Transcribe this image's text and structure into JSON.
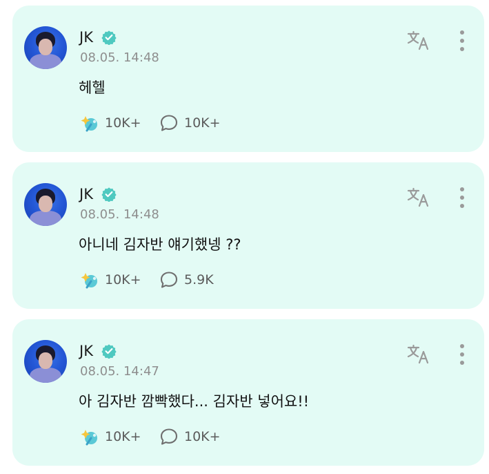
{
  "posts": [
    {
      "author": "JK",
      "timestamp": "08.05. 14:48",
      "message": "헤헬",
      "likes": "10K+",
      "comments": "10K+"
    },
    {
      "author": "JK",
      "timestamp": "08.05. 14:48",
      "message": "아니네 김자반 얘기했넹 ??",
      "likes": "10K+",
      "comments": "5.9K"
    },
    {
      "author": "JK",
      "timestamp": "08.05. 14:47",
      "message": "아 김자반 깜빡했다... 김자반 넣어요!!",
      "likes": "10K+",
      "comments": "10K+"
    }
  ],
  "icons": {
    "verified": "verified-badge-icon",
    "translate": "translate-icon",
    "more": "more-vertical-icon",
    "like": "sparkle-like-icon",
    "comment": "comment-bubble-icon"
  },
  "colors": {
    "card_background": "#e3fbf5",
    "verified_badge": "#4fc9c0",
    "count_text": "#5b5b5b",
    "timestamp_text": "#8e8e8e"
  }
}
